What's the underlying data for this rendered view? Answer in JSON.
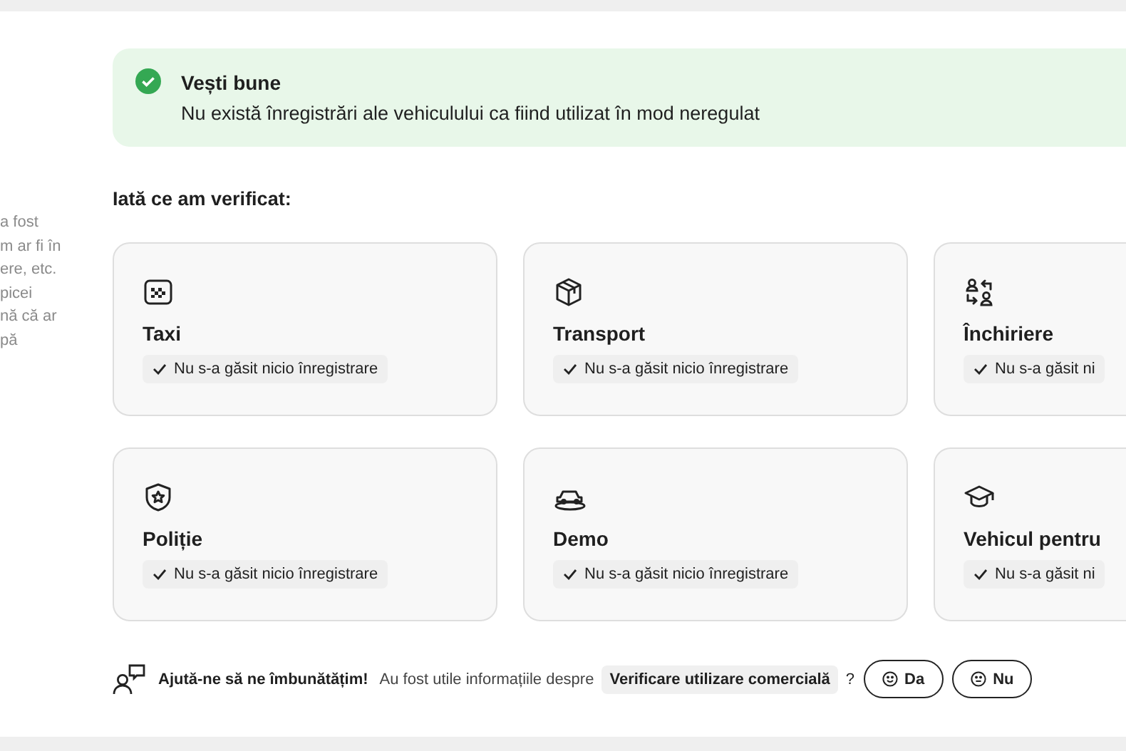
{
  "sidebar": {
    "lines": [
      "a fost",
      "m ar fi în",
      "ere, etc.",
      "picei",
      "nă că ar",
      "pă"
    ]
  },
  "banner": {
    "title": "Vești bune",
    "message": "Nu există înregistrări ale vehiculului ca fiind utilizat în mod neregulat"
  },
  "checks": {
    "heading": "Iată ce am verificat:",
    "cards": [
      {
        "title": "Taxi",
        "result": "Nu s-a găsit nicio înregistrare"
      },
      {
        "title": "Transport",
        "result": "Nu s-a găsit nicio înregistrare"
      },
      {
        "title": "Închiriere",
        "result": "Nu s-a găsit ni"
      },
      {
        "title": "Poliție",
        "result": "Nu s-a găsit nicio înregistrare"
      },
      {
        "title": "Demo",
        "result": "Nu s-a găsit nicio înregistrare"
      },
      {
        "title": "Vehicul pentru",
        "result": "Nu s-a găsit ni"
      }
    ]
  },
  "feedback": {
    "prompt": "Ajută-ne să ne îmbunătățim!",
    "question": "Au fost utile informațiile despre",
    "topic": "Verificare utilizare comercială",
    "question_mark": "?",
    "buttons": [
      "Da",
      "Nu"
    ]
  }
}
